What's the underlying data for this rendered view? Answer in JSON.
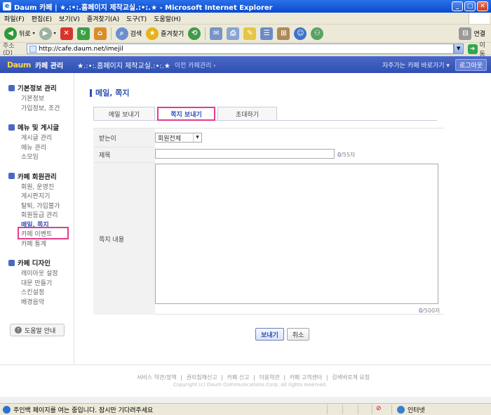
{
  "window": {
    "title": "Daum 카페 | ★.:•:.홈페이지 제작교실.:•:.★ - Microsoft Internet Explorer",
    "buttons": [
      "_",
      "□",
      "✕"
    ]
  },
  "menu": [
    "파일(F)",
    "편집(E)",
    "보기(V)",
    "즐겨찾기(A)",
    "도구(T)",
    "도움말(H)"
  ],
  "toolbar": {
    "back_label": "뒤로",
    "search_label": "검색",
    "favorites_label": "즐겨찾기",
    "links_label": "연결"
  },
  "address": {
    "label": "주소(D)",
    "url": "http://cafe.daum.net/imejil",
    "go_label": "이동"
  },
  "header": {
    "logo": "Daum",
    "cafe_admin": "카페 관리",
    "cafe_name": "★.:•:.홈페이지 제작교실.:•:.★",
    "prev_admin": "이전 카페관리 ›",
    "shortcut": "자주가는 카페 바로가기 ▾",
    "logout": "로그아웃"
  },
  "sidebar": {
    "sections": [
      {
        "title": "기본정보 관리",
        "items": [
          "기본정보",
          "가입정보, 조건"
        ]
      },
      {
        "title": "메뉴 및 게시글",
        "items": [
          "게시글 관리",
          "메뉴 관리",
          "소모임"
        ]
      },
      {
        "title": "카페 회원관리",
        "items": [
          "회원, 운영진",
          "게시판지기",
          "탈퇴, 가입불가",
          "회원등급 관리",
          "메일, 쪽지",
          "카페 이벤트",
          "카페 통계"
        ]
      },
      {
        "title": "카페 디자인",
        "items": [
          "레이아웃 설정",
          "대문 만들기",
          "스킨설정",
          "배경음악"
        ]
      }
    ],
    "help": "도움말 안내"
  },
  "main": {
    "title": "메일, 쪽지",
    "tabs": [
      "메일 보내기",
      "쪽지 보내기",
      "초대하기"
    ],
    "form": {
      "recipient_label": "받는이",
      "recipient_value": "회원전체",
      "subject_label": "제목",
      "subject_count": "0",
      "subject_max": "/55자",
      "content_label": "쪽지 내용",
      "content_count": "0",
      "content_max": "/500자"
    },
    "send_button": "보내기",
    "cancel_button": "취소"
  },
  "footer": {
    "links": [
      "서비스 약관/정책",
      "|",
      "권리침해신고",
      "|",
      "카페 신고",
      "|",
      "이용약관",
      "|",
      "카페 고객센터",
      "|",
      "검색바로게 요청"
    ],
    "copyright": "Copyright (c) Daum Communications Corp. All rights reserved."
  },
  "status": {
    "text": "주인백 페이지를 여는 중입니다. 잠시만 기다려주세요",
    "zone": "인터넷"
  }
}
